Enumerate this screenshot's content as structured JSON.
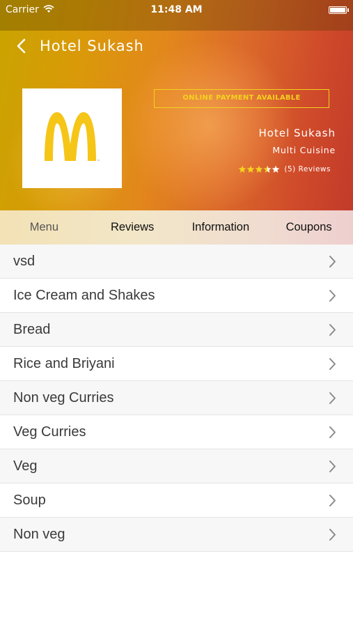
{
  "status_bar": {
    "carrier": "Carrier",
    "time": "11:48 AM"
  },
  "nav": {
    "title": "Hotel Sukash",
    "back_icon": "chevron-left-icon"
  },
  "restaurant": {
    "logo_icon": "mcdonalds-logo",
    "payment_badge": "ONLINE PAYMENT AVAILABLE",
    "name": "Hotel Sukash",
    "cuisine": "Multi Cuisine",
    "rating": 3.5,
    "rating_max": 5,
    "reviews_label": "(5) Reviews"
  },
  "tabs": [
    {
      "label": "Menu",
      "active": true
    },
    {
      "label": "Reviews",
      "active": false
    },
    {
      "label": "Information",
      "active": false
    },
    {
      "label": "Coupons",
      "active": false
    }
  ],
  "menu_categories": [
    {
      "label": "vsd"
    },
    {
      "label": "Ice Cream and Shakes"
    },
    {
      "label": "Bread"
    },
    {
      "label": "Rice and Briyani"
    },
    {
      "label": "Non veg Curries"
    },
    {
      "label": "Veg Curries"
    },
    {
      "label": "Veg"
    },
    {
      "label": "Soup"
    },
    {
      "label": "Non veg"
    }
  ],
  "colors": {
    "badge": "#f3d21f",
    "star_filled": "#f3d21f",
    "star_empty": "#ffffff"
  }
}
